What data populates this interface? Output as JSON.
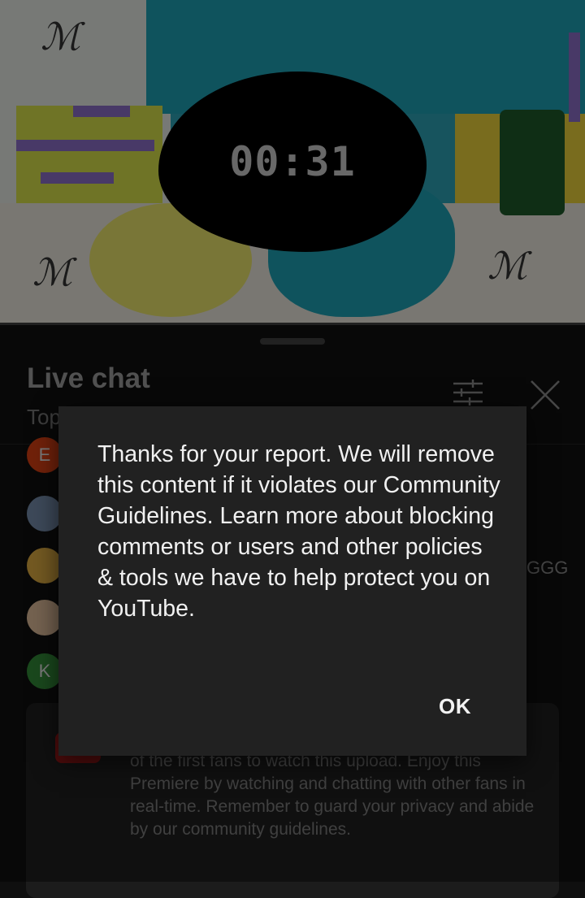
{
  "video": {
    "timer": "00:31"
  },
  "chat": {
    "title": "Live chat",
    "subtitle": "Top",
    "partial_message_text": "GGG",
    "avatars": [
      {
        "initial": "E",
        "color": "#c13a12"
      },
      {
        "initial": "",
        "color": "#6a7f9a"
      },
      {
        "initial": "",
        "color": "#c79a3b"
      },
      {
        "initial": "",
        "color": "#c9a98a"
      },
      {
        "initial": "K",
        "color": "#2e7d32"
      }
    ],
    "info_card_text": "of the first fans to watch this upload. Enjoy this Premiere by watching and chatting with other fans in real-time. Remember to guard your privacy and abide by our community guidelines."
  },
  "dialog": {
    "message": "Thanks for your report. We will remove this content if it violates our Community Guidelines. Learn more about blocking comments or users and other policies & tools we have to help protect you on YouTube.",
    "ok_label": "OK"
  },
  "icons": {
    "filter": "filter-icon",
    "close": "close-icon"
  }
}
